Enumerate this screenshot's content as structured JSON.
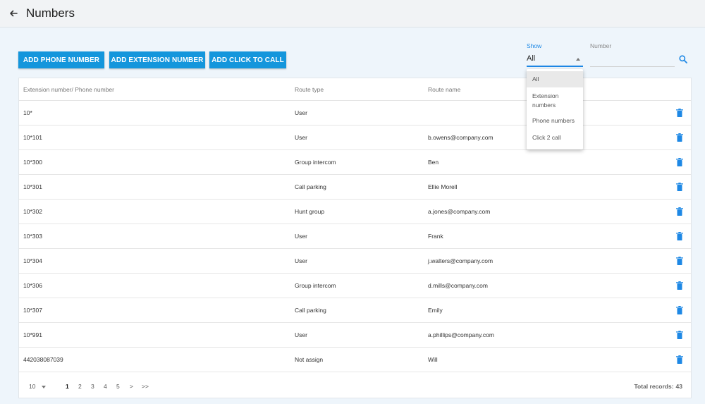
{
  "header": {
    "title": "Numbers",
    "back_icon": "arrow-left-icon"
  },
  "toolbar": {
    "add_phone": "ADD PHONE NUMBER",
    "add_extension": "ADD EXTENSION NUMBER",
    "add_click": "ADD CLICK TO CALL",
    "accent_color": "#1496dc"
  },
  "filters": {
    "show_label": "Show",
    "show_value": "All",
    "number_label": "Number",
    "number_value": "",
    "search_icon": "search-icon"
  },
  "dropdown": {
    "options": [
      "All",
      "Extension numbers",
      "Phone numbers",
      "Click 2 call"
    ],
    "selected": "All"
  },
  "table": {
    "columns": [
      "Extension number/ Phone number",
      "Route type",
      "Route name"
    ],
    "rows": [
      {
        "number": "10*",
        "route_type": "User",
        "route_name": ""
      },
      {
        "number": "10*101",
        "route_type": "User",
        "route_name": "b.owens@company.com"
      },
      {
        "number": "10*300",
        "route_type": "Group intercom",
        "route_name": "Ben"
      },
      {
        "number": "10*301",
        "route_type": "Call parking",
        "route_name": "Ellie Morell"
      },
      {
        "number": "10*302",
        "route_type": "Hunt group",
        "route_name": "a.jones@company.com"
      },
      {
        "number": "10*303",
        "route_type": "User",
        "route_name": "Frank"
      },
      {
        "number": "10*304",
        "route_type": "User",
        "route_name": "j.walters@company.com"
      },
      {
        "number": "10*306",
        "route_type": "Group intercom",
        "route_name": "d.mills@company.com"
      },
      {
        "number": "10*307",
        "route_type": "Call parking",
        "route_name": "Emily"
      },
      {
        "number": "10*991",
        "route_type": "User",
        "route_name": "a.phillips@company.com"
      },
      {
        "number": "442038087039",
        "route_type": "Not assign",
        "route_name": "Will"
      }
    ],
    "delete_icon": "trash-icon",
    "delete_color": "#1e88e5"
  },
  "pagination": {
    "page_size": "10",
    "pages": [
      "1",
      "2",
      "3",
      "4",
      "5"
    ],
    "current": "1",
    "next": ">",
    "last": ">>",
    "total_label": "Total records:",
    "total": "43"
  }
}
